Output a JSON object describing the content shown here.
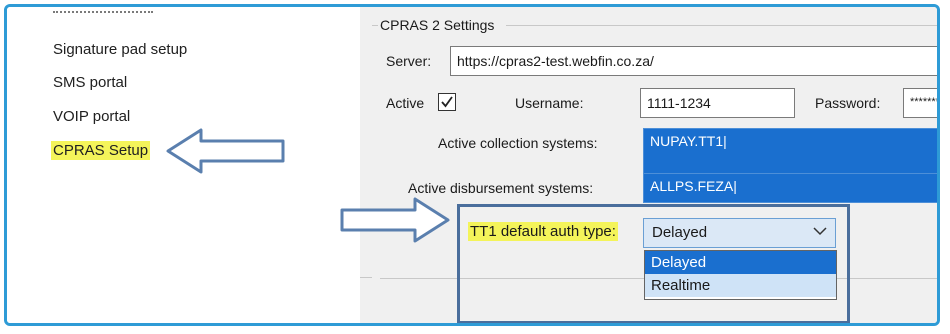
{
  "nav": {
    "items": [
      {
        "label": "Signature pad setup"
      },
      {
        "label": "SMS portal"
      },
      {
        "label": "VOIP portal"
      },
      {
        "label": "CPRAS Setup",
        "selected": true
      }
    ]
  },
  "settings": {
    "group_title": "CPRAS 2 Settings",
    "server_label": "Server:",
    "server_value": "https://cpras2-test.webfin.co.za/",
    "active_label": "Active",
    "active_checked": true,
    "username_label": "Username:",
    "username_value": "1111-1234",
    "password_label": "Password:",
    "password_value": "**********",
    "collection_label": "Active collection systems:",
    "collection_value": "NUPAY.TT1|",
    "disbursement_label": "Active disbursement systems:",
    "disbursement_value": "ALLPS.FEZA|",
    "auth_label": "TT1 default auth type:",
    "auth_selected": "Delayed",
    "auth_options": [
      "Delayed",
      "Realtime"
    ]
  },
  "colors": {
    "highlight": "#f4f45a",
    "selection_blue": "#1a6fcf",
    "frame_border": "#2e9bd6",
    "callout_border": "#4a6e9c"
  },
  "icons": [
    "left-arrow-icon",
    "right-arrow-icon",
    "checkmark-icon",
    "chevron-down-icon"
  ]
}
